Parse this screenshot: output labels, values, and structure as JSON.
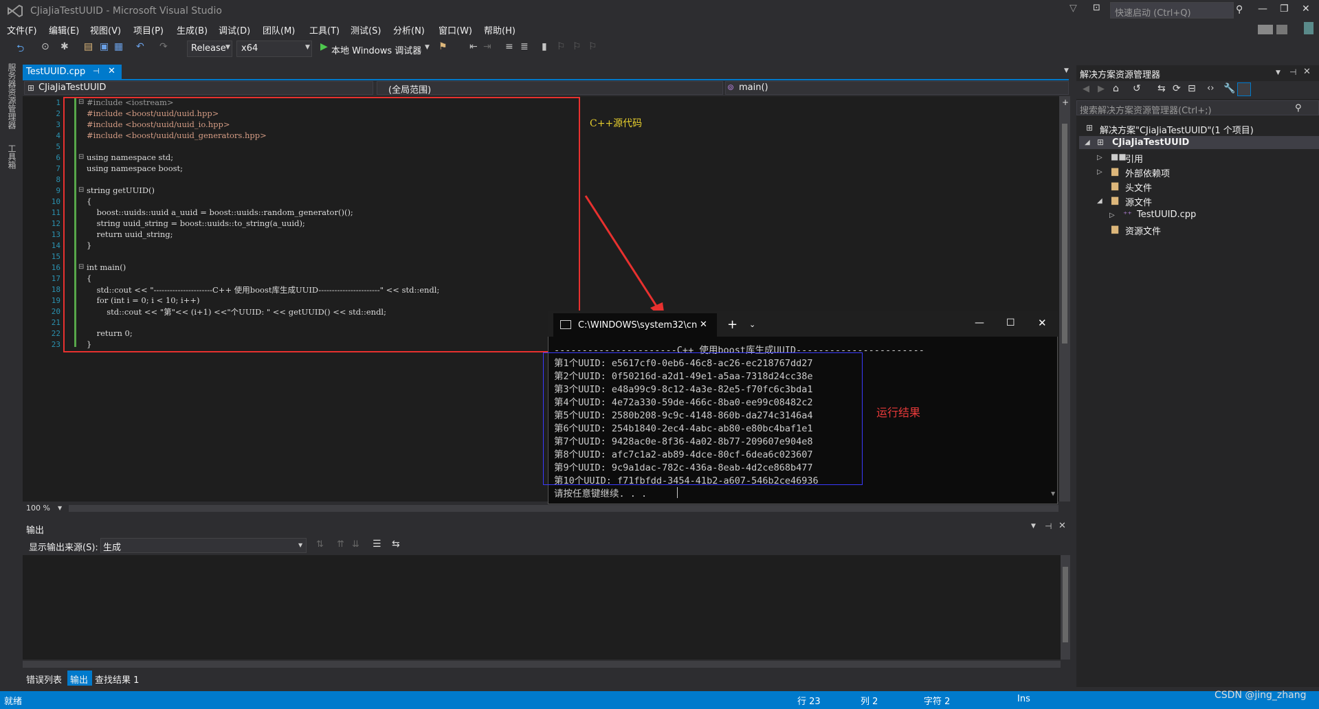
{
  "window": {
    "title": "CJiaJiaTestUUID - Microsoft Visual Studio",
    "quick_launch_placeholder": "快速启动 (Ctrl+Q)"
  },
  "menu": [
    "文件(F)",
    "编辑(E)",
    "视图(V)",
    "项目(P)",
    "生成(B)",
    "调试(D)",
    "团队(M)",
    "工具(T)",
    "测试(S)",
    "分析(N)",
    "窗口(W)",
    "帮助(H)"
  ],
  "toolbar": {
    "configuration": "Release",
    "platform": "x64",
    "run_label": "本地 Windows 调试器"
  },
  "left_vertical_tabs": [
    "服务器资源管理器",
    "工具箱"
  ],
  "editor": {
    "tab_name": "TestUUID.cpp",
    "nav": {
      "project": "CJiaJiaTestUUID",
      "scope": "(全局范围)",
      "member": "main()"
    },
    "zoom": "100 %",
    "line_numbers": [
      "1",
      "2",
      "3",
      "4",
      "5",
      "6",
      "7",
      "8",
      "9",
      "10",
      "11",
      "12",
      "13",
      "14",
      "15",
      "16",
      "17",
      "18",
      "19",
      "20",
      "21",
      "22",
      "23"
    ],
    "lines": {
      "l1": "#include <iostream>",
      "l2": "#include <boost/uuid/uuid.hpp>",
      "l3": "#include <boost/uuid/uuid_io.hpp>",
      "l4": "#include <boost/uuid/uuid_generators.hpp>",
      "l6": "using namespace std;",
      "l7": "using namespace boost;",
      "l9": "string getUUID()",
      "l10": "{",
      "l11": "    boost::uuids::uuid a_uuid = boost::uuids::random_generator()();",
      "l12": "    string uuid_string = boost::uuids::to_string(a_uuid);",
      "l13": "    return uuid_string;",
      "l14": "}",
      "l16": "int main()",
      "l17": "{",
      "l18": "    std::cout << \"----------------------C++ 使用boost库生成UUID-----------------------\" << std::endl;",
      "l19": "    for (int i = 0; i < 10; i++)",
      "l20": "        std::cout << \"第\"<< (i+1) <<\"个UUID: \" << getUUID() << std::endl;",
      "l22": "    return 0;",
      "l23": "}"
    }
  },
  "annotations": {
    "code_label": "C++源代码",
    "result_label": "运行结果"
  },
  "console": {
    "tab_title": "C:\\WINDOWS\\system32\\cn",
    "header": "----------------------C++ 使用boost库生成UUID-----------------------",
    "lines": [
      "第1个UUID: e5617cf0-0eb6-46c8-ac26-ec218767dd27",
      "第2个UUID: 0f50216d-a2d1-49e1-a5aa-7318d24cc38e",
      "第3个UUID: e48a99c9-8c12-4a3e-82e5-f70fc6c3bda1",
      "第4个UUID: 4e72a330-59de-466c-8ba0-ee99c08482c2",
      "第5个UUID: 2580b208-9c9c-4148-860b-da274c3146a4",
      "第6个UUID: 254b1840-2ec4-4abc-ab80-e80bc4baf1e1",
      "第7个UUID: 9428ac0e-8f36-4a02-8b77-209607e904e8",
      "第8个UUID: afc7c1a2-ab89-4dce-80cf-6dea6c023607",
      "第9个UUID: 9c9a1dac-782c-436a-8eab-4d2ce868b477",
      "第10个UUID: f71fbfdd-3454-41b2-a607-546b2ce46936"
    ],
    "prompt": "请按任意键继续. . ."
  },
  "output": {
    "title": "输出",
    "source_label": "显示输出来源(S):",
    "source_value": "生成"
  },
  "bottom_tabs": [
    "错误列表",
    "输出",
    "查找结果 1"
  ],
  "solution": {
    "title": "解决方案资源管理器",
    "search_placeholder": "搜索解决方案资源管理器(Ctrl+;)",
    "root": "解决方案\"CJiaJiaTestUUID\"(1 个项目)",
    "project": "CJiaJiaTestUUID",
    "items": [
      "引用",
      "外部依赖项",
      "头文件",
      "源文件",
      "TestUUID.cpp",
      "资源文件"
    ]
  },
  "status": {
    "ready": "就绪",
    "row": "行 23",
    "col": "列 2",
    "char": "字符 2",
    "ins": "Ins"
  },
  "watermark": "CSDN @jing_zhang"
}
